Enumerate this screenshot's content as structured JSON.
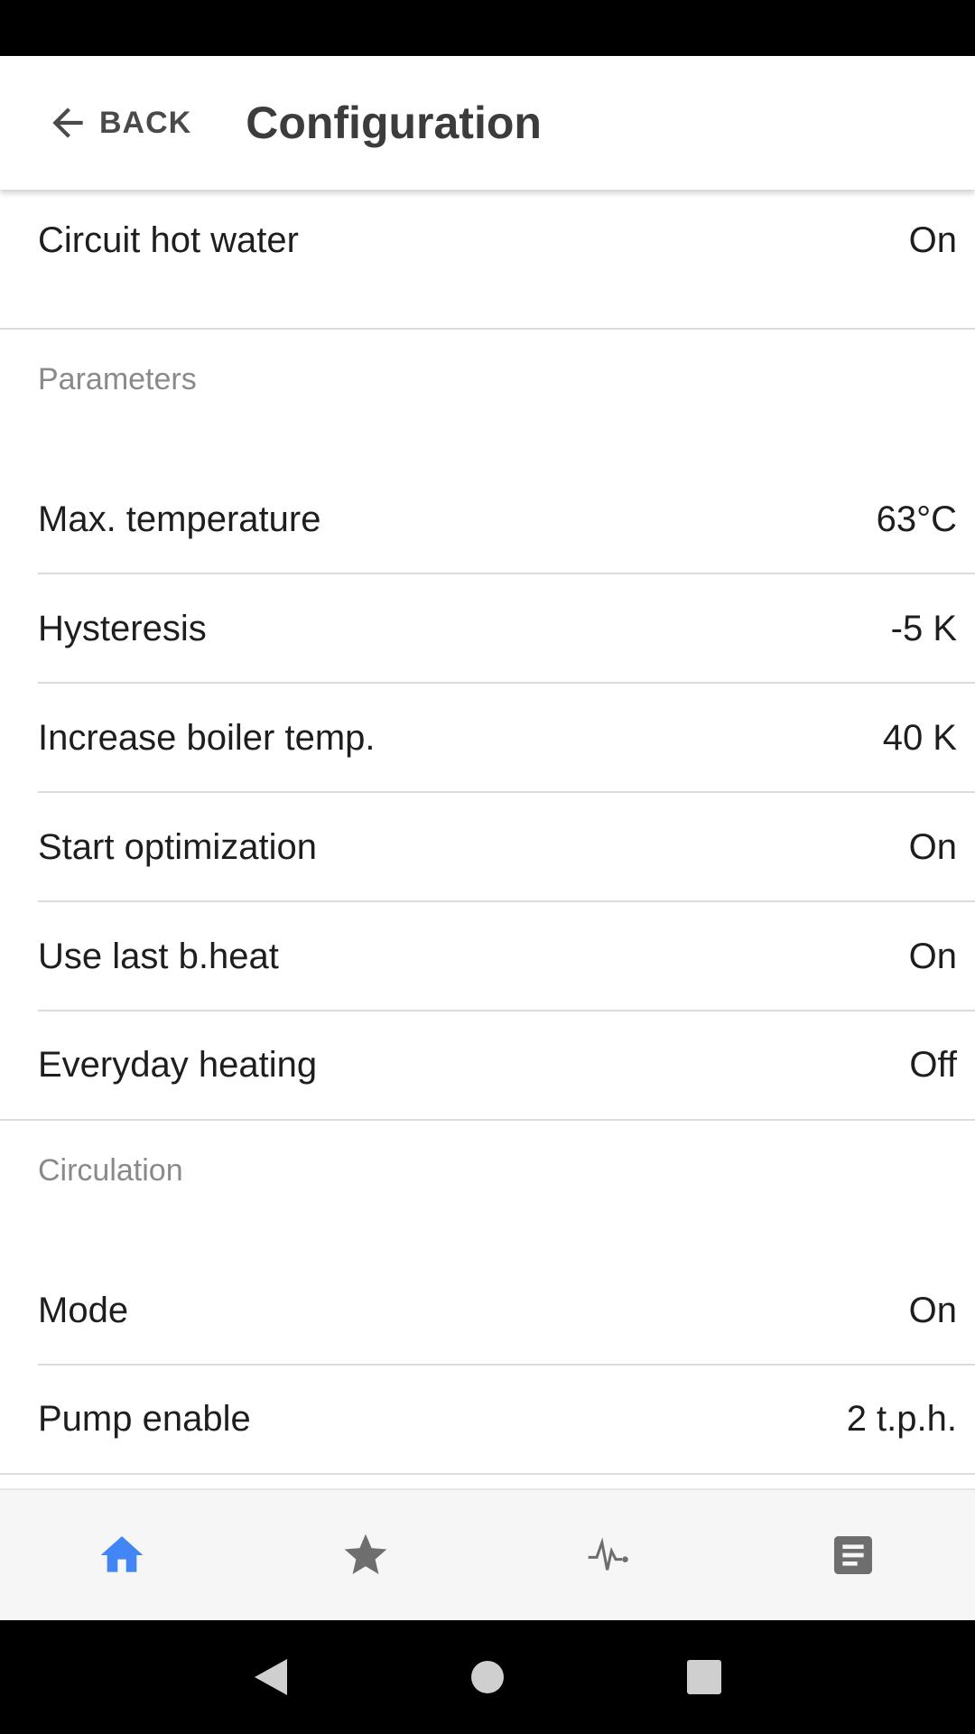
{
  "header": {
    "back_label": "BACK",
    "title": "Configuration"
  },
  "top_row": {
    "label": "Circuit hot water",
    "value": "On"
  },
  "sections": {
    "parameters": {
      "title": "Parameters",
      "rows": [
        {
          "label": "Max. temperature",
          "value": "63°C"
        },
        {
          "label": "Hysteresis",
          "value": "-5 K"
        },
        {
          "label": "Increase boiler temp.",
          "value": "40 K"
        },
        {
          "label": "Start optimization",
          "value": "On"
        },
        {
          "label": "Use last b.heat",
          "value": "On"
        },
        {
          "label": "Everyday heating",
          "value": "Off"
        }
      ]
    },
    "circulation": {
      "title": "Circulation",
      "rows": [
        {
          "label": "Mode",
          "value": "On"
        },
        {
          "label": "Pump enable",
          "value": "2 t.p.h."
        }
      ]
    }
  },
  "bottom_nav": {
    "items": [
      {
        "icon": "home-icon",
        "active": true
      },
      {
        "icon": "star-icon",
        "active": false
      },
      {
        "icon": "pulse-icon",
        "active": false
      },
      {
        "icon": "document-icon",
        "active": false
      }
    ],
    "active_color": "#4285f4",
    "inactive_color": "#6e6e6e"
  },
  "system_nav": {
    "icons": [
      "back-triangle-icon",
      "home-circle-icon",
      "recents-square-icon"
    ]
  }
}
